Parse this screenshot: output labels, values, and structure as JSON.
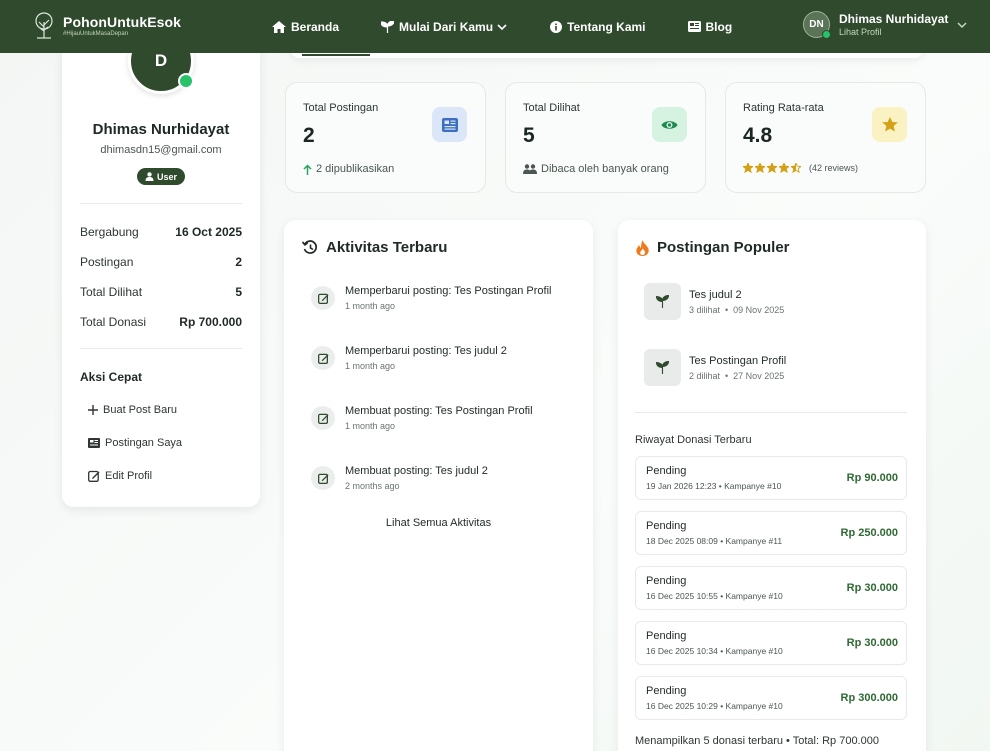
{
  "nav": {
    "brand_name": "PohonUntukEsok",
    "brand_tagline": "#HijauUntukMasaDepan",
    "links": [
      "Beranda",
      "Mulai Dari Kamu",
      "Tentang Kami",
      "Blog"
    ],
    "user_initials": "DN",
    "user_name": "Dhimas Nurhidayat",
    "user_sub": "Lihat Profil"
  },
  "profile": {
    "initial": "D",
    "name": "Dhimas Nurhidayat",
    "email": "dhimasdn15@gmail.com",
    "role": "User",
    "stats": [
      {
        "label": "Bergabung",
        "value": "16 Oct 2025"
      },
      {
        "label": "Postingan",
        "value": "2"
      },
      {
        "label": "Total Dilihat",
        "value": "5"
      },
      {
        "label": "Total Donasi",
        "value": "Rp 700.000"
      }
    ],
    "quick_title": "Aksi Cepat",
    "actions": [
      "Buat Post Baru",
      "Postingan Saya",
      "Edit Profil"
    ]
  },
  "stats": [
    {
      "title": "Total Postingan",
      "value": "2",
      "sub": "2 dipublikasikan"
    },
    {
      "title": "Total Dilihat",
      "value": "5",
      "sub": "Dibaca oleh banyak orang"
    },
    {
      "title": "Rating Rata-rata",
      "value": "4.8",
      "sub": "(42 reviews)",
      "rating": 4.5
    }
  ],
  "activity": {
    "title": "Aktivitas Terbaru",
    "items": [
      {
        "title": "Memperbarui posting: Tes Postingan Profil",
        "time": "1 month ago"
      },
      {
        "title": "Memperbarui posting: Tes judul 2",
        "time": "1 month ago"
      },
      {
        "title": "Membuat posting: Tes Postingan Profil",
        "time": "1 month ago"
      },
      {
        "title": "Membuat posting: Tes judul 2",
        "time": "2 months ago"
      }
    ],
    "view_all": "Lihat Semua Aktivitas"
  },
  "popular": {
    "title": "Postingan Populer",
    "items": [
      {
        "title": "Tes judul 2",
        "meta": "3 dilihat  •  09 Nov 2025"
      },
      {
        "title": "Tes Postingan Profil",
        "meta": "2 dilihat  •  27 Nov 2025"
      }
    ],
    "donation_title": "Riwayat Donasi Terbaru",
    "donations": [
      {
        "status": "Pending",
        "meta": "19 Jan 2026 12:23 • Kampanye #10",
        "amount": "Rp 90.000"
      },
      {
        "status": "Pending",
        "meta": "18 Dec 2025 08:09 • Kampanye #11",
        "amount": "Rp 250.000"
      },
      {
        "status": "Pending",
        "meta": "16 Dec 2025 10:55 • Kampanye #10",
        "amount": "Rp 30.000"
      },
      {
        "status": "Pending",
        "meta": "16 Dec 2025 10:34 • Kampanye #10",
        "amount": "Rp 30.000"
      },
      {
        "status": "Pending",
        "meta": "16 Dec 2025 10:29 • Kampanye #10",
        "amount": "Rp 300.000"
      }
    ],
    "donation_footer": "Menampilkan 5 donasi terbaru • Total: Rp 700.000"
  },
  "colors": {
    "primary": "#2f4a2c",
    "online": "#27c26a",
    "amount": "#2f6a34",
    "star": "#d4a017"
  }
}
